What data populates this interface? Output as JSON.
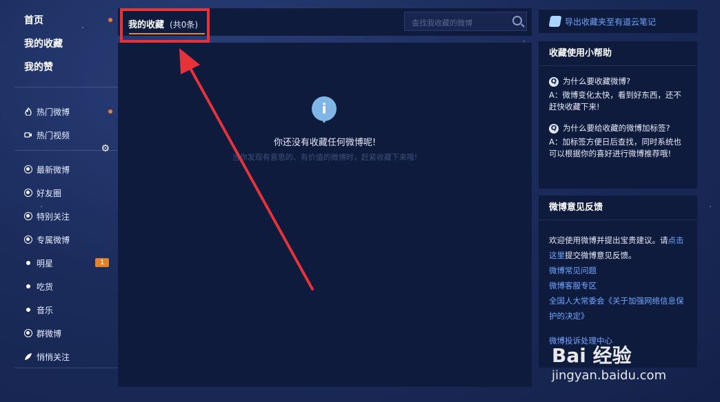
{
  "nav": {
    "top": [
      {
        "label": "首页"
      },
      {
        "label": "我的收藏"
      },
      {
        "label": "我的赞"
      }
    ],
    "mid": [
      {
        "label": "热门微博",
        "icon": "fire-icon"
      },
      {
        "label": "热门视频",
        "icon": "video-icon"
      }
    ],
    "groups": [
      {
        "label": "最新微博",
        "icon": "star-circle-icon"
      },
      {
        "label": "好友圈",
        "icon": "heart-circle-icon"
      },
      {
        "label": "特别关注",
        "icon": "eye-circle-icon"
      },
      {
        "label": "专属微博",
        "icon": "chart-circle-icon"
      },
      {
        "label": "明星",
        "icon": "bullet",
        "badge": "1"
      },
      {
        "label": "吃货",
        "icon": "bullet"
      },
      {
        "label": "音乐",
        "icon": "bullet"
      },
      {
        "label": "群微博",
        "icon": "group-circle-icon"
      },
      {
        "label": "悄悄关注",
        "icon": "leaf-icon"
      }
    ]
  },
  "main": {
    "tab_label": "我的收藏",
    "tab_count": "(共0条)",
    "search_placeholder": "查找我收藏的微博",
    "empty_title": "你还没有收藏任何微博呢!",
    "empty_sub": "当你发现有意思的、有价值的微博时，赶紧收藏下来哦!"
  },
  "right": {
    "export_label": "导出收藏夹至有道云笔记",
    "help_title": "收藏使用小帮助",
    "help": [
      {
        "q": "为什么要收藏微博?",
        "a": "A：微博变化太快，看到好东西，还不赶快收藏下来!"
      },
      {
        "q": "为什么要给收藏的微博加标签?",
        "a": "A：加标签方便日后查找，同时系统也可以根据你的喜好进行微博推荐哦!"
      }
    ],
    "feedback_title": "微博意见反馈",
    "feedback_text_1": "欢迎使用微博并提出宝贵建议。请",
    "feedback_link_1": "点击这里",
    "feedback_text_2": "提交微博意见反馈。",
    "links": [
      "微博常见问题",
      "微博客服专区",
      "全国人大常委会《关于加强网络信息保护的决定》"
    ],
    "complaint_link": "微博投诉处理中心"
  },
  "watermark": {
    "logo": "Bai 经验",
    "sub": "jingyan.baidu.com"
  },
  "colors": {
    "accent": "#e8863d",
    "link": "#6fa6ff",
    "highlight": "#e5333a",
    "panel": "#0f1b3d"
  }
}
